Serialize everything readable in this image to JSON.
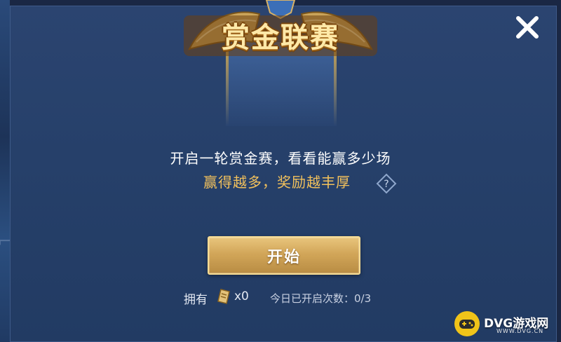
{
  "header": {
    "title": "赏金联赛"
  },
  "dialog": {
    "line1": "开启一轮赏金赛，看看能赢多少场",
    "line2": "赢得越多，奖励越丰厚",
    "start_label": "开始",
    "own_label": "拥有",
    "own_count": "x0",
    "today_label": "今日已开启次数：0/3"
  },
  "icons": {
    "close": "close-icon",
    "help": "help-diamond-icon",
    "ticket": "ticket-icon",
    "emblem": "league-emblem-icon"
  },
  "watermark": {
    "brand": "DVG游戏网",
    "url": "WWW.DVG.CN"
  },
  "colors": {
    "panel": "#26406a",
    "gold": "#f2c15c",
    "button": "#d2a659"
  }
}
